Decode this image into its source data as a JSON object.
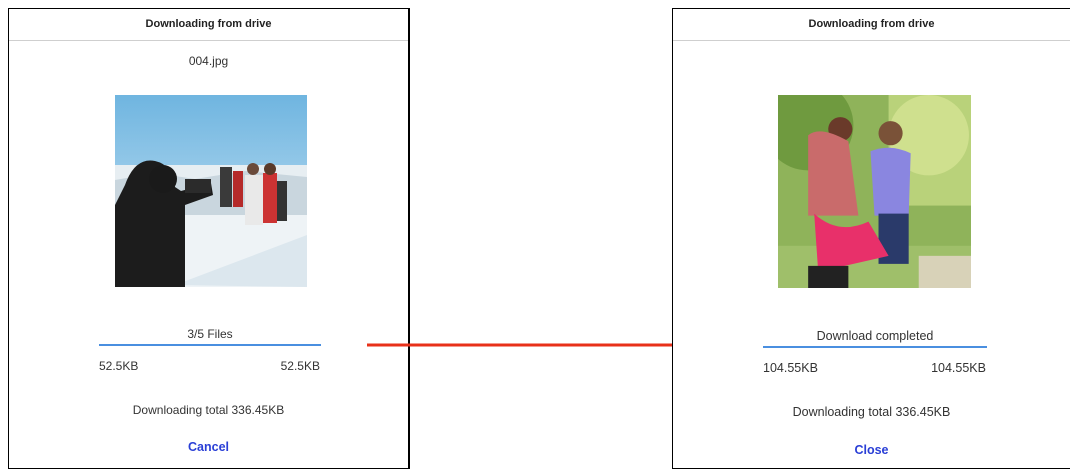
{
  "left_dialog": {
    "title": "Downloading from drive",
    "file_name": "004.jpg",
    "status": "3/5 Files",
    "progress": 1.0,
    "size_downloaded": "52.5KB",
    "size_total": "52.5KB",
    "total_text": "Downloading total 336.45KB",
    "action_label": "Cancel"
  },
  "right_dialog": {
    "title": "Downloading from drive",
    "status": "Download completed",
    "progress": 1.0,
    "size_downloaded": "104.55KB",
    "size_total": "104.55KB",
    "total_text": "Downloading total 336.45KB",
    "action_label": "Close"
  },
  "colors": {
    "accent": "#2a3fd6",
    "progress": "#4a8fe0",
    "arrow": "#e8311a"
  }
}
